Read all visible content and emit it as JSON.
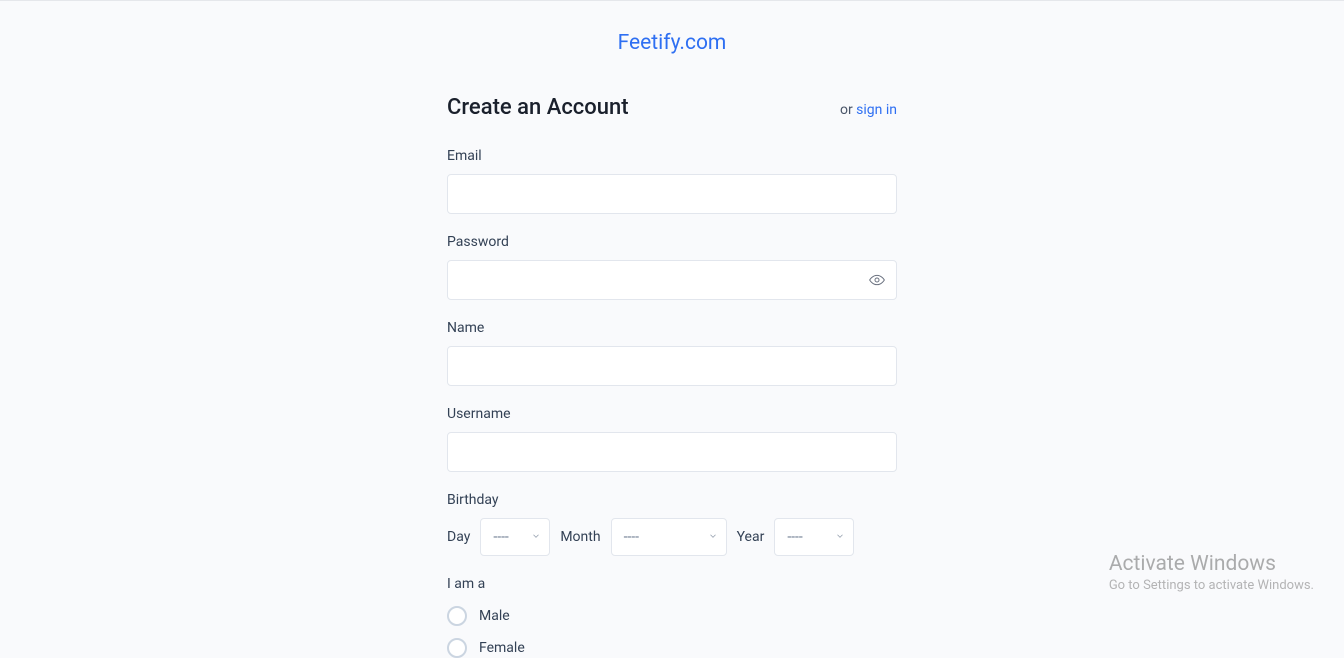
{
  "logo": "Feetify.com",
  "header": {
    "title": "Create an Account",
    "or_text": "or ",
    "signin_text": "sign in"
  },
  "fields": {
    "email_label": "Email",
    "password_label": "Password",
    "name_label": "Name",
    "username_label": "Username",
    "birthday_label": "Birthday",
    "day_label": "Day",
    "month_label": "Month",
    "year_label": "Year",
    "day_value": "----",
    "month_value": "----",
    "year_value": "----"
  },
  "gender": {
    "section_label": "I am a",
    "male_label": "Male",
    "female_label": "Female"
  },
  "watermark": {
    "title": "Activate Windows",
    "subtitle": "Go to Settings to activate Windows."
  }
}
